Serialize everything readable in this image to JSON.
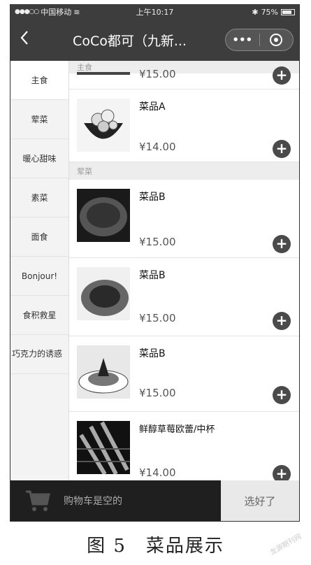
{
  "status_bar": {
    "carrier": "中国移动",
    "time": "上午10:17",
    "battery": "75%"
  },
  "nav": {
    "title": "CoCo都可（九新...",
    "more_label": "•••"
  },
  "sidebar": {
    "items": [
      {
        "label": "主食"
      },
      {
        "label": "荤菜"
      },
      {
        "label": "暖心甜味"
      },
      {
        "label": "素菜"
      },
      {
        "label": "面食"
      },
      {
        "label": "Bonjour!"
      },
      {
        "label": "食积救星"
      },
      {
        "label": "巧克力的诱惑"
      }
    ]
  },
  "menu": {
    "sections": [
      {
        "header": "主食",
        "partial_price": "¥15.00"
      },
      {
        "header": "荤菜"
      }
    ],
    "items": [
      {
        "name": "菜品A",
        "price": "¥14.00"
      },
      {
        "name": "菜品B",
        "price": "¥15.00"
      },
      {
        "name": "菜品B",
        "price": "¥15.00"
      },
      {
        "name": "菜品B",
        "price": "¥15.00"
      },
      {
        "name": "鲜醇草莓欧蕾/中杯",
        "price": "¥14.00"
      }
    ],
    "add_symbol": "+"
  },
  "cart": {
    "empty_text": "购物车是空的",
    "checkout_label": "选好了"
  },
  "caption": "图 5　菜品展示",
  "watermark": "龙源期刊网",
  "colors": {
    "bar": "#3d3d3d",
    "cart_bar": "#1f1f1f",
    "add_button": "#4a4a4a"
  }
}
